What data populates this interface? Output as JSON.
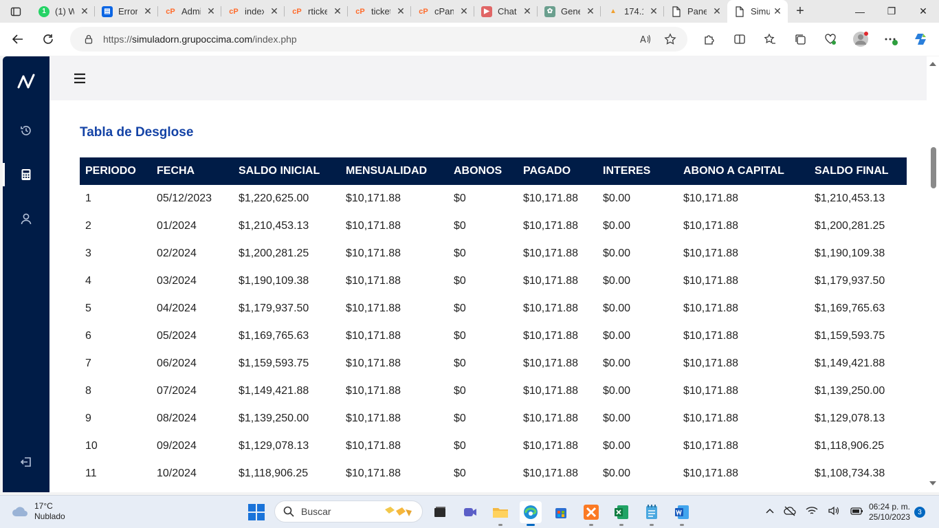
{
  "browser": {
    "tabs": [
      {
        "title": "(1) W",
        "icon": "whatsapp-icon",
        "color": "#25d366",
        "glyph": "1"
      },
      {
        "title": "Error",
        "icon": "trello-icon",
        "color": "#0c66e4",
        "glyph": "▤"
      },
      {
        "title": "Admi",
        "icon": "cpanel-icon",
        "color": "#ff6c2c",
        "glyph": "cP"
      },
      {
        "title": "index",
        "icon": "cpanel-icon",
        "color": "#ff6c2c",
        "glyph": "cP"
      },
      {
        "title": "rticke",
        "icon": "cpanel-icon",
        "color": "#ff6c2c",
        "glyph": "cP"
      },
      {
        "title": "ticket",
        "icon": "cpanel-icon",
        "color": "#ff6c2c",
        "glyph": "cP"
      },
      {
        "title": "cPan",
        "icon": "cpanel-icon",
        "color": "#ff6c2c",
        "glyph": "cP"
      },
      {
        "title": "Chat",
        "icon": "youtube-icon",
        "color": "#e06666",
        "glyph": "▶"
      },
      {
        "title": "Gene",
        "icon": "chatgpt-icon",
        "color": "#6a9f8e",
        "glyph": "✿"
      },
      {
        "title": "174.1",
        "icon": "phpmyadmin-icon",
        "color": "#f0a030",
        "glyph": "▲"
      },
      {
        "title": "Pane",
        "icon": "page-icon",
        "color": "#ffffff",
        "glyph": ""
      },
      {
        "title": "Simu",
        "icon": "page-icon",
        "color": "#ffffff",
        "glyph": "",
        "active": true
      }
    ],
    "address": {
      "url_prefix": "https://",
      "url_host": "simuladorn.grupoccima.com",
      "url_path": "/index.php"
    }
  },
  "app": {
    "section_title": "Tabla de Desglose",
    "table": {
      "headers": [
        "PERIODO",
        "FECHA",
        "SALDO INICIAL",
        "MENSUALIDAD",
        "ABONOS",
        "PAGADO",
        "INTERES",
        "ABONO A CAPITAL",
        "SALDO FINAL"
      ],
      "rows": [
        [
          "1",
          "05/12/2023",
          "$1,220,625.00",
          "$10,171.88",
          "$0",
          "$10,171.88",
          "$0.00",
          "$10,171.88",
          "$1,210,453.13"
        ],
        [
          "2",
          "01/2024",
          "$1,210,453.13",
          "$10,171.88",
          "$0",
          "$10,171.88",
          "$0.00",
          "$10,171.88",
          "$1,200,281.25"
        ],
        [
          "3",
          "02/2024",
          "$1,200,281.25",
          "$10,171.88",
          "$0",
          "$10,171.88",
          "$0.00",
          "$10,171.88",
          "$1,190,109.38"
        ],
        [
          "4",
          "03/2024",
          "$1,190,109.38",
          "$10,171.88",
          "$0",
          "$10,171.88",
          "$0.00",
          "$10,171.88",
          "$1,179,937.50"
        ],
        [
          "5",
          "04/2024",
          "$1,179,937.50",
          "$10,171.88",
          "$0",
          "$10,171.88",
          "$0.00",
          "$10,171.88",
          "$1,169,765.63"
        ],
        [
          "6",
          "05/2024",
          "$1,169,765.63",
          "$10,171.88",
          "$0",
          "$10,171.88",
          "$0.00",
          "$10,171.88",
          "$1,159,593.75"
        ],
        [
          "7",
          "06/2024",
          "$1,159,593.75",
          "$10,171.88",
          "$0",
          "$10,171.88",
          "$0.00",
          "$10,171.88",
          "$1,149,421.88"
        ],
        [
          "8",
          "07/2024",
          "$1,149,421.88",
          "$10,171.88",
          "$0",
          "$10,171.88",
          "$0.00",
          "$10,171.88",
          "$1,139,250.00"
        ],
        [
          "9",
          "08/2024",
          "$1,139,250.00",
          "$10,171.88",
          "$0",
          "$10,171.88",
          "$0.00",
          "$10,171.88",
          "$1,129,078.13"
        ],
        [
          "10",
          "09/2024",
          "$1,129,078.13",
          "$10,171.88",
          "$0",
          "$10,171.88",
          "$0.00",
          "$10,171.88",
          "$1,118,906.25"
        ],
        [
          "11",
          "10/2024",
          "$1,118,906.25",
          "$10,171.88",
          "$0",
          "$10,171.88",
          "$0.00",
          "$10,171.88",
          "$1,108,734.38"
        ]
      ]
    },
    "colors": {
      "sidebar": "#001c47",
      "title": "#1443a6",
      "header_bg": "#001c47"
    }
  },
  "taskbar": {
    "weather_temp": "17°C",
    "weather_desc": "Nublado",
    "search_label": "Buscar",
    "time": "06:24 p. m.",
    "date": "25/10/2023",
    "notifications": "3"
  }
}
